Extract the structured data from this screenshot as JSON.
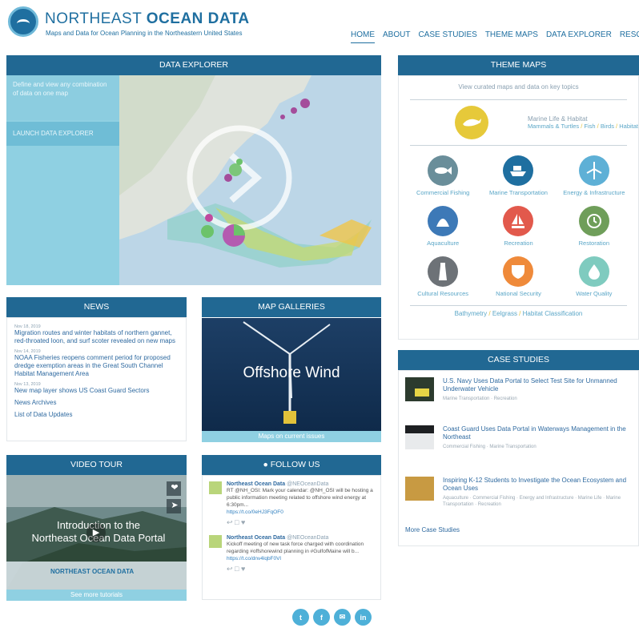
{
  "header": {
    "title_light": "NORTHEAST ",
    "title_bold": "OCEAN DATA",
    "subtitle": "Maps and Data for Ocean Planning in the Northeastern United States",
    "nav": [
      "HOME",
      "ABOUT",
      "CASE STUDIES",
      "THEME MAPS",
      "DATA EXPLORER",
      "RESOURCES"
    ]
  },
  "data_explorer": {
    "heading": "DATA EXPLORER",
    "description": "Define and view any combination of data on one map",
    "launch": "LAUNCH DATA EXPLORER"
  },
  "news": {
    "heading": "NEWS",
    "items": [
      {
        "date": "Nov 18, 2019",
        "title": "Migration routes and winter habitats of northern gannet, red-throated loon, and surf scoter revealed on new maps"
      },
      {
        "date": "Nov 14, 2019",
        "title": "NOAA Fisheries reopens comment period for proposed dredge exemption areas in the Great South Channel Habitat Management Area"
      },
      {
        "date": "Nov 13, 2019",
        "title": "New map layer shows US Coast Guard Sectors"
      }
    ],
    "archives": "News Archives",
    "updates": "List of Data Updates"
  },
  "galleries": {
    "heading": "MAP GALLERIES",
    "image_text": "Offshore Wind",
    "caption": "Maps on current issues"
  },
  "video": {
    "heading": "VIDEO TOUR",
    "title_line1": "Introduction to the",
    "title_line2": "Northeast Ocean Data Portal",
    "brand": "NORTHEAST OCEAN DATA",
    "caption": "See more tutorials"
  },
  "follow": {
    "heading": "FOLLOW US",
    "tweets": [
      {
        "name": "Northeast Ocean Data",
        "handle": "@NEOceanData",
        "text": "RT @NH_OSI: Mark your calendar: @NH_OSI will be hosting a public information meeting related to offshore wind energy at 6:30pm...",
        "link": "https://t.co/0eHJ3FqOF0"
      },
      {
        "name": "Northeast Ocean Data",
        "handle": "@NEOceanData",
        "text": "Kickoff meeting of new task force charged with coordination regarding #offshorewind planning in #GulfofMaine will b...",
        "link": "https://t.co/dnv4lqbF0Vl"
      }
    ]
  },
  "theme_maps": {
    "heading": "THEME MAPS",
    "intro": "View curated maps and data on key topics",
    "featured": {
      "title": "Marine Life & Habitat",
      "links": [
        "Mammals & Turtles",
        "Fish",
        "Birds",
        "Habitat"
      ]
    },
    "themes": [
      {
        "label": "Commercial Fishing",
        "color": "#6a8e9a",
        "icon": "fish-icon"
      },
      {
        "label": "Marine Transportation",
        "color": "#1f6fa0",
        "icon": "ship-icon"
      },
      {
        "label": "Energy & Infrastructure",
        "color": "#5eb0d6",
        "icon": "wind-turbine-icon"
      },
      {
        "label": "Aquaculture",
        "color": "#3d79b7",
        "icon": "shell-icon"
      },
      {
        "label": "Recreation",
        "color": "#e2594c",
        "icon": "sailboat-icon"
      },
      {
        "label": "Restoration",
        "color": "#6f9e5a",
        "icon": "restore-icon"
      },
      {
        "label": "Cultural Resources",
        "color": "#6d7277",
        "icon": "lighthouse-icon"
      },
      {
        "label": "National Security",
        "color": "#ef8a3a",
        "icon": "shield-icon"
      },
      {
        "label": "Water Quality",
        "color": "#7fcbbf",
        "icon": "droplet-icon"
      }
    ],
    "footer_links": [
      "Bathymetry",
      "Eelgrass",
      "Habitat Classification"
    ]
  },
  "case_studies": {
    "heading": "CASE STUDIES",
    "items": [
      {
        "title": "U.S. Navy Uses Data Portal to Select Test Site for Unmanned Underwater Vehicle",
        "tags": "Marine Transportation · Recreation"
      },
      {
        "title": "Coast Guard Uses Data Portal in Waterways Management in the Northeast",
        "tags": "Commercial Fishing · Marine Transportation"
      },
      {
        "title": "Inspiring K-12 Students to Investigate the Ocean Ecosystem and Ocean Uses",
        "tags": "Aquaculture · Commercial Fishing · Energy and Infrastructure · Marine Life · Marine Transportation · Recreation"
      }
    ],
    "more": "More Case Studies"
  },
  "social": [
    "twitter-icon",
    "facebook-icon",
    "email-icon",
    "linkedin-icon"
  ],
  "colors": {
    "brand": "#216893",
    "accent": "#8fd0e2",
    "link": "#2f6aa0"
  }
}
